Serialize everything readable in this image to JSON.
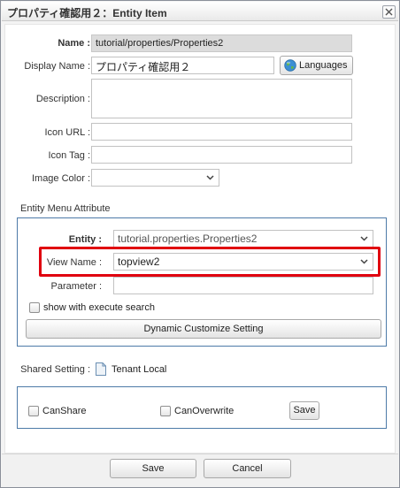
{
  "dialog": {
    "title": "プロパティ確認用２：Entity Item",
    "close_icon": "close-icon"
  },
  "form": {
    "name_label": "Name :",
    "name_value": "tutorial/properties/Properties2",
    "display_name_label": "Display Name :",
    "display_name_value": "プロパティ確認用２",
    "languages_button": "Languages",
    "description_label": "Description :",
    "description_value": "",
    "icon_url_label": "Icon URL :",
    "icon_url_value": "",
    "icon_tag_label": "Icon Tag :",
    "icon_tag_value": "",
    "image_color_label": "Image Color :",
    "image_color_value": ""
  },
  "entity_menu": {
    "section_title": "Entity Menu Attribute",
    "entity_label": "Entity :",
    "entity_value": "tutorial.properties.Properties2",
    "view_name_label": "View Name :",
    "view_name_value": "topview2",
    "parameter_label": "Parameter :",
    "parameter_value": "",
    "execute_search_label": "show with execute search",
    "execute_search_checked": false,
    "dynamic_button": "Dynamic Customize Setting"
  },
  "shared": {
    "label": "Shared Setting :",
    "value": "Tenant Local",
    "can_share_label": "CanShare",
    "can_share_checked": false,
    "can_overwrite_label": "CanOverwrite",
    "can_overwrite_checked": false,
    "save_button": "Save"
  },
  "footer": {
    "save_button": "Save",
    "cancel_button": "Cancel"
  },
  "colors": {
    "panel_border": "#4d7aa8",
    "highlight": "#e0000f"
  }
}
